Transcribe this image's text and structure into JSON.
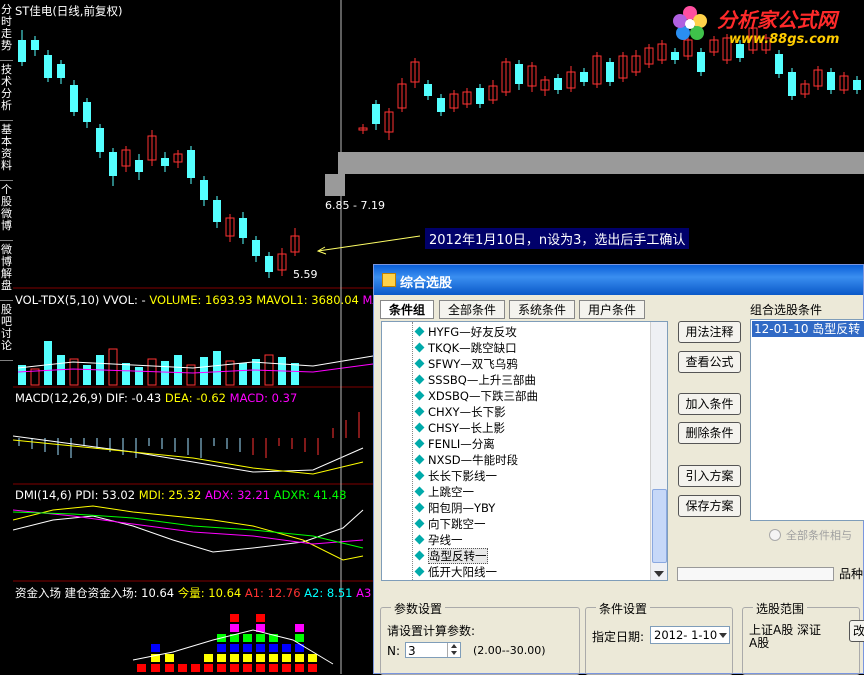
{
  "nav": [
    "分时走势",
    "技术分析",
    "基本资料",
    "个股微博",
    "微博解盘",
    "股吧讨论"
  ],
  "main_panel": {
    "title": "ST佳电(日线,前复权)",
    "price_high_label": "6.85 - 7.19",
    "price_low_label": "5.59",
    "annotation": "2012年1月10日，n设为3，选出后手工确认"
  },
  "watermark": {
    "brand": "分析家公式网",
    "url": "www.88gs.com"
  },
  "vol_panel": {
    "name": "VOL-TDX(5,10)",
    "vvol": "VVOL: -",
    "volume": "VOLUME: 1693.93",
    "mavol1": "MAVOL1: 3680.04",
    "mavol2": "MA"
  },
  "macd_panel": {
    "name": "MACD(12,26,9)",
    "dif": "DIF: -0.43",
    "dea": "DEA: -0.62",
    "macd": "MACD: 0.37"
  },
  "dmi_panel": {
    "name": "DMI(14,6)",
    "pdi": "PDI: 53.02",
    "mdi": "MDI: 25.32",
    "adx": "ADX: 32.21",
    "adxr": "ADXR: 41.48"
  },
  "fund_panel": {
    "name": "资金入场",
    "build": "建仓资金入场: 10.64",
    "amount": "今量: 10.64",
    "a1": "A1: 12.76",
    "a2": "A2: 8.51",
    "a3": "A3"
  },
  "dialog": {
    "title": "综合选股",
    "tabs": [
      "条件组",
      "全部条件",
      "系统条件",
      "用户条件"
    ],
    "tree_items": [
      "HYFG—好友反攻",
      "TKQK—跳空缺口",
      "SFWY—双飞乌鸦",
      "SSSBQ—上升三部曲",
      "XDSBQ—下跌三部曲",
      "CHXY—长下影",
      "CHSY—长上影",
      "FENLI—分离",
      "NXSD—牛能时段",
      "长长下影线一",
      "上跳空一",
      "阳包阴—YBY",
      "向下跳空一",
      "孕线一",
      "岛型反转一",
      "低开大阳线一"
    ],
    "selected_tree_item": "岛型反转一",
    "buttons": [
      "用法注释",
      "查看公式",
      "加入条件",
      "删除条件",
      "引入方案",
      "保存方案"
    ],
    "combo_label": "组合选股条件",
    "combo_items": [
      "12-01-10 岛型反转"
    ],
    "all_conditions_and": "全部条件相与",
    "variety_label": "品种",
    "params_group": "参数设置",
    "params_prompt": "请设置计算参数:",
    "param_n_label": "N:",
    "param_n_value": "3",
    "param_range": "(2.00--30.00)",
    "cond_group": "条件设置",
    "date_label": "指定日期:",
    "date_value": "2012- 1-10",
    "scope_group": "选股范围",
    "scope_text": "上证A股 深证A股",
    "change_button": "改"
  },
  "colors": {
    "up": "#ff3232",
    "down": "#54ffff",
    "bg": "#000000",
    "accent_yellow": "#ffff00",
    "dialog_bg": "#ece9d8"
  }
}
